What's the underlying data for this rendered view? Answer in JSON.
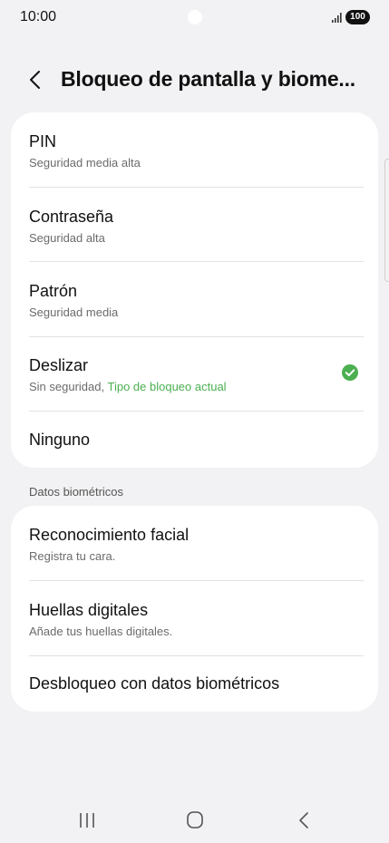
{
  "status_bar": {
    "time": "10:00",
    "battery": "100",
    "signal_icon": "signal-bars-icon"
  },
  "header": {
    "back_icon": "chevron-left-icon",
    "title": "Bloqueo de pantalla y biome..."
  },
  "lock_types": [
    {
      "title": "PIN",
      "subtitle": "Seguridad media alta"
    },
    {
      "title": "Contraseña",
      "subtitle": "Seguridad alta"
    },
    {
      "title": "Patrón",
      "subtitle": "Seguridad media"
    },
    {
      "title": "Deslizar",
      "subtitle": "Sin seguridad, ",
      "current": "Tipo de bloqueo actual",
      "selected": true
    },
    {
      "title": "Ninguno"
    }
  ],
  "biometrics": {
    "section_label": "Datos biométricos",
    "items": [
      {
        "title": "Reconocimiento facial",
        "subtitle": "Registra tu cara."
      },
      {
        "title": "Huellas digitales",
        "subtitle": "Añade tus huellas digitales."
      },
      {
        "title": "Desbloqueo con datos biométricos"
      }
    ]
  },
  "nav_bar": {
    "recents_icon": "recents-icon",
    "home_icon": "home-icon",
    "back_icon": "back-nav-icon"
  },
  "colors": {
    "accent_green": "#4caf50",
    "background": "#f2f2f4",
    "card": "#ffffff"
  }
}
